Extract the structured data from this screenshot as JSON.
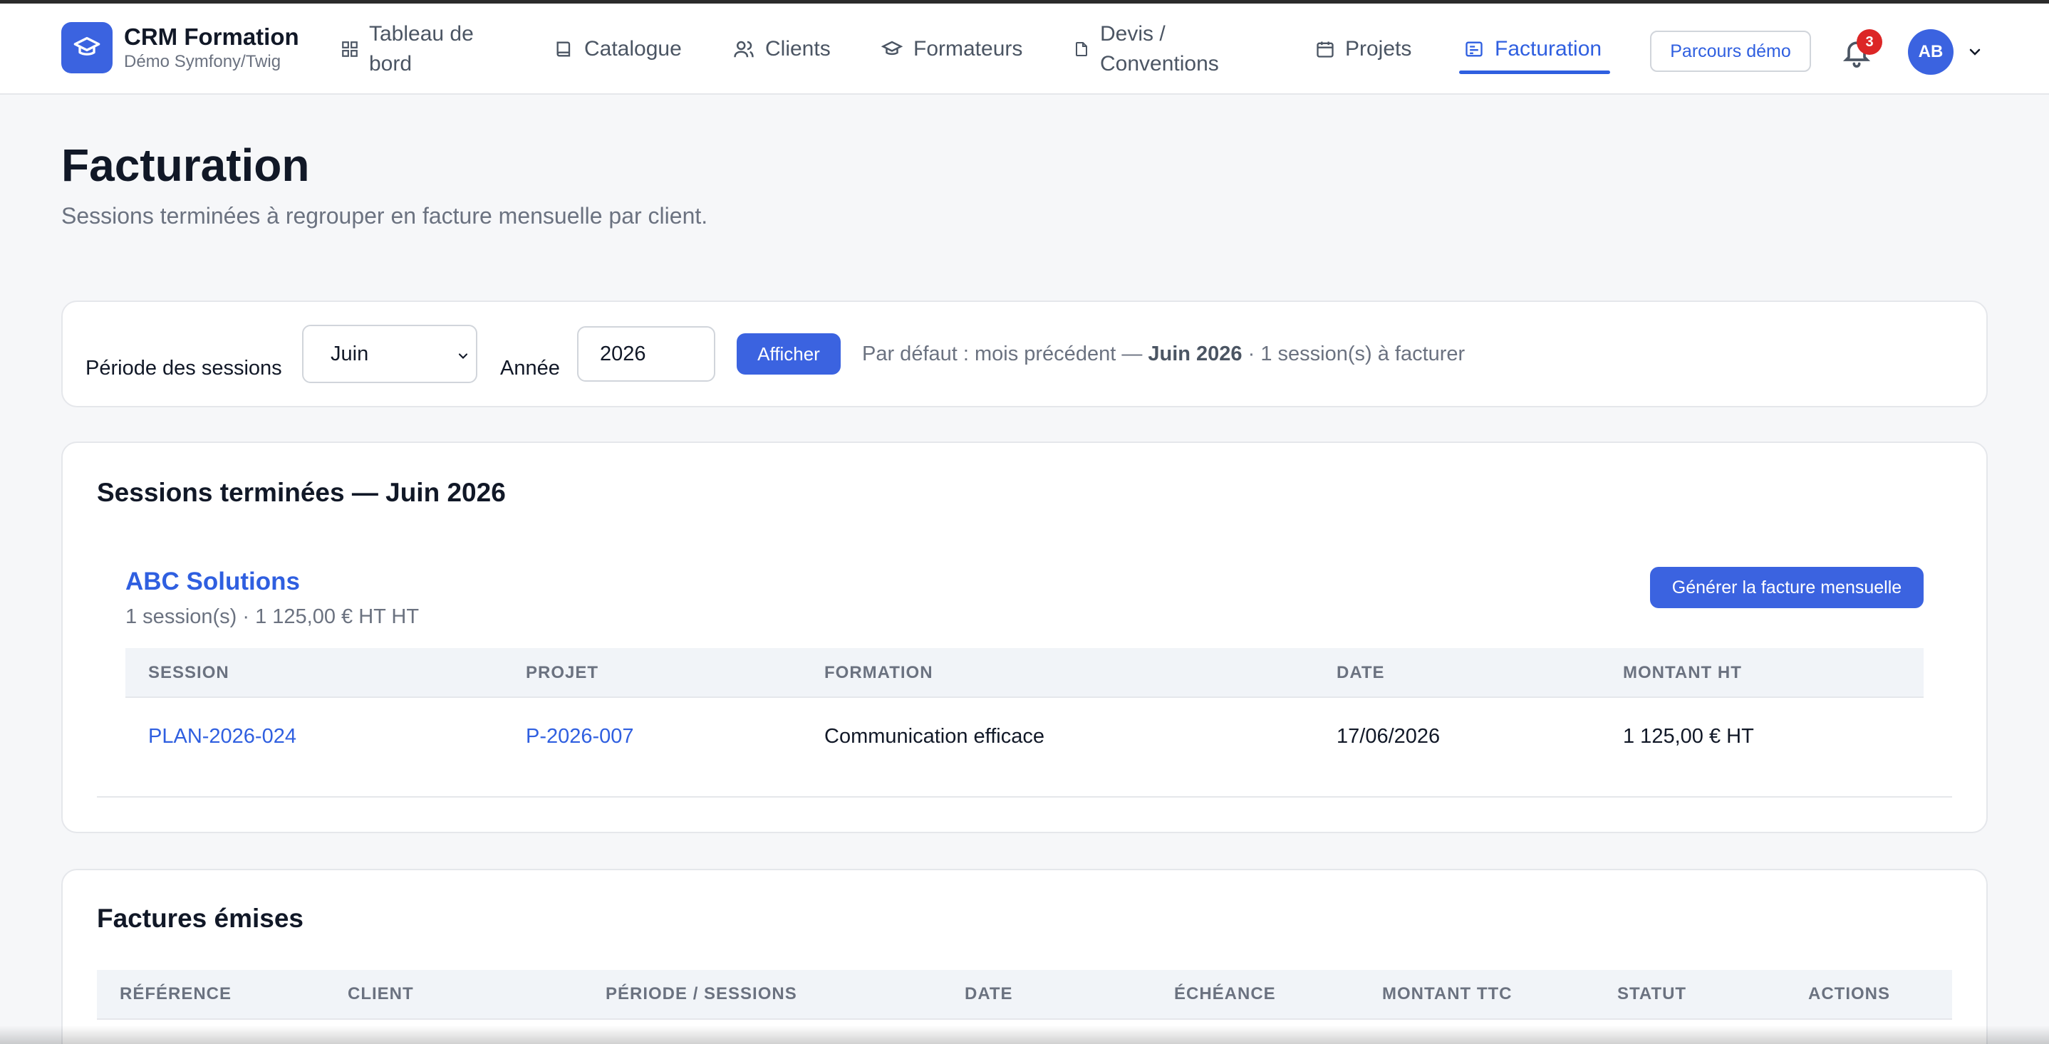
{
  "brand": {
    "name": "CRM Formation",
    "subtitle": "Démo Symfony/Twig",
    "icon": "graduation-cap-icon"
  },
  "nav": {
    "items": [
      {
        "label_line1": "Tableau de",
        "label_line2": "bord",
        "icon": "dashboard-icon"
      },
      {
        "label": "Catalogue",
        "icon": "book-icon"
      },
      {
        "label": "Clients",
        "icon": "users-icon"
      },
      {
        "label": "Formateurs",
        "icon": "graduation-cap-icon"
      },
      {
        "label_line1": "Devis /",
        "label_line2": "Conventions",
        "icon": "document-icon"
      },
      {
        "label": "Projets",
        "icon": "calendar-icon"
      },
      {
        "label": "Facturation",
        "icon": "invoice-icon",
        "active": true
      }
    ],
    "demo_button": "Parcours démo",
    "notifications_count": "3",
    "avatar_initials": "AB"
  },
  "page": {
    "title": "Facturation",
    "subtitle": "Sessions terminées à regrouper en facture mensuelle par client."
  },
  "filter": {
    "period_label": "Période des sessions",
    "month_value": "Juin",
    "year_label": "Année",
    "year_value": "2026",
    "submit_label": "Afficher",
    "info_prefix": "Par défaut : mois précédent — ",
    "info_period": "Juin 2026",
    "info_suffix": " · 1 session(s) à facturer"
  },
  "sessions": {
    "title": "Sessions terminées — Juin 2026",
    "client": {
      "name": "ABC Solutions",
      "meta": "1 session(s) · 1 125,00 € HT HT",
      "generate_label": "Générer la facture mensuelle"
    },
    "columns": [
      "SESSION",
      "PROJET",
      "FORMATION",
      "DATE",
      "MONTANT HT"
    ],
    "rows": [
      {
        "session": "PLAN-2026-024",
        "projet": "P-2026-007",
        "formation": "Communication efficace",
        "date": "17/06/2026",
        "montant": "1 125,00 € HT"
      }
    ]
  },
  "invoices": {
    "title": "Factures émises",
    "columns": [
      "RÉFÉRENCE",
      "CLIENT",
      "PÉRIODE / SESSIONS",
      "DATE",
      "ÉCHÉANCE",
      "MONTANT TTC",
      "STATUT",
      "ACTIONS"
    ]
  },
  "colors": {
    "accent": "#2f5fe0",
    "brand": "#3b63e0",
    "badge": "#dc2626",
    "background": "#f6f7f9"
  }
}
